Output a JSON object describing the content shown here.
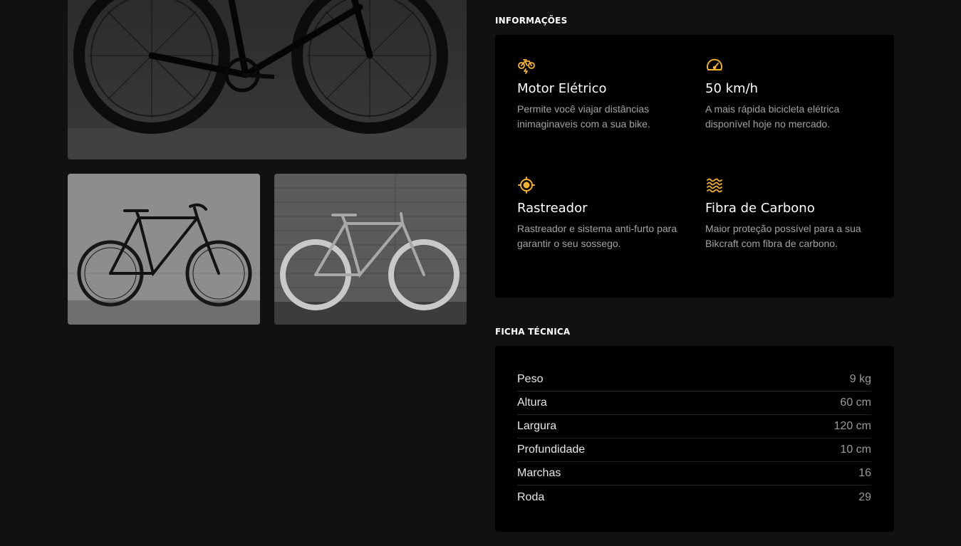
{
  "colors": {
    "accent": "#f7b32b",
    "background": "#111111",
    "panel": "#000000"
  },
  "gallery": {
    "images": [
      {
        "name": "bike-main-photo",
        "alt": "dark road bike close-up"
      },
      {
        "name": "bike-black-photo",
        "alt": "black fixed gear bike against concrete wall"
      },
      {
        "name": "bike-white-photo",
        "alt": "light fixed gear bike against shutter"
      }
    ]
  },
  "info": {
    "title": "Informações",
    "features": [
      {
        "icon": "electric-bike-icon",
        "title": "Motor Elétrico",
        "text": "Permite você viajar distâncias inimaginaveis com a sua bike."
      },
      {
        "icon": "speedometer-icon",
        "title": "50 km/h",
        "text": "A mais rápida bicicleta elétrica disponível hoje no mercado."
      },
      {
        "icon": "tracker-icon",
        "title": "Rastreador",
        "text": "Rastreador e sistema anti-furto para garantir o seu sossego."
      },
      {
        "icon": "carbon-waves-icon",
        "title": "Fibra de Carbono",
        "text": "Maior proteção possível para a sua Bikcraft com fibra de carbono."
      }
    ]
  },
  "specs": {
    "title": "Ficha Técnica",
    "rows": [
      {
        "label": "Peso",
        "value": "9 kg"
      },
      {
        "label": "Altura",
        "value": "60 cm"
      },
      {
        "label": "Largura",
        "value": "120 cm"
      },
      {
        "label": "Profundidade",
        "value": "10 cm"
      },
      {
        "label": "Marchas",
        "value": "16"
      },
      {
        "label": "Roda",
        "value": "29"
      }
    ]
  }
}
